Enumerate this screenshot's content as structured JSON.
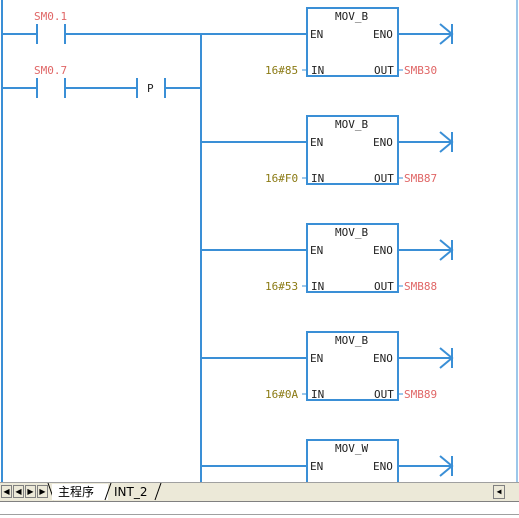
{
  "colors": {
    "wire": "#3a8fd6",
    "contact_label": "#e06666",
    "in_operand": "#8b7a14",
    "out_operand": "#e06666"
  },
  "contacts": [
    {
      "label": "SM0.1"
    },
    {
      "label": "SM0.7"
    }
  ],
  "edge_contact": {
    "label": "P"
  },
  "blocks": [
    {
      "title": "MOV_B",
      "en": "EN",
      "eno": "ENO",
      "in_pin": "IN",
      "out_pin": "OUT",
      "in_value": "16#85",
      "out_value": "SMB30"
    },
    {
      "title": "MOV_B",
      "en": "EN",
      "eno": "ENO",
      "in_pin": "IN",
      "out_pin": "OUT",
      "in_value": "16#F0",
      "out_value": "SMB87"
    },
    {
      "title": "MOV_B",
      "en": "EN",
      "eno": "ENO",
      "in_pin": "IN",
      "out_pin": "OUT",
      "in_value": "16#53",
      "out_value": "SMB88"
    },
    {
      "title": "MOV_B",
      "en": "EN",
      "eno": "ENO",
      "in_pin": "IN",
      "out_pin": "OUT",
      "in_value": "16#0A",
      "out_value": "SMB89"
    },
    {
      "title": "MOV_W",
      "en": "EN",
      "eno": "ENO"
    }
  ],
  "tabs": [
    {
      "label": "主程序",
      "active": true
    },
    {
      "label": "INT_2",
      "active": false
    }
  ],
  "nav_buttons": [
    "left-first",
    "prev",
    "next-end"
  ]
}
